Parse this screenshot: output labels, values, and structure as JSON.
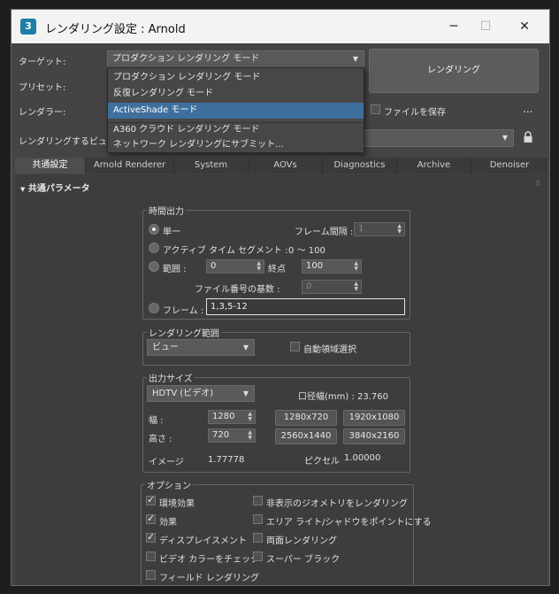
{
  "window": {
    "app_icon": "3",
    "title": "レンダリング設定 : Arnold",
    "minimize": "─",
    "maximize": "☐",
    "close": "✕"
  },
  "header": {
    "target_label": "ターゲット:",
    "target_value": "プロダクション レンダリング モード",
    "preset_label": "プリセット:",
    "renderer_label": "レンダラー:",
    "save_file_label": "ファイルを保存",
    "more": "...",
    "view_label": "レンダリングするビュー:",
    "render_button": "レンダリング",
    "lock_icon": "lock-icon"
  },
  "target_menu": {
    "items": [
      "プロダクション レンダリング モード",
      "反復レンダリング モード",
      "ActiveShade モード",
      "A360 クラウド レンダリング モード",
      "ネットワーク レンダリングにサブミット..."
    ],
    "selected_index": 2
  },
  "tabs": [
    "共通設定",
    "Arnold Renderer",
    "System",
    "AOVs",
    "Diagnostics",
    "Archive",
    "Denoiser"
  ],
  "section": {
    "title": "共通パラメータ",
    "collapse_icon": "▼"
  },
  "time_output": {
    "title": "時間出力",
    "single": "単一",
    "frame_interval_label": "フレーム間隔 :",
    "frame_interval_value": "1",
    "active_segment": "アクティブ タイム セグメント :",
    "active_segment_value": "0 〜 100",
    "range": "範囲 :",
    "range_start": "0",
    "range_end_label": "終点",
    "range_end": "100",
    "file_number_label": "ファイル番号の基数 :",
    "file_number_value": "0",
    "frames": "フレーム :",
    "frames_value": "1,3,5-12"
  },
  "render_area": {
    "title": "レンダリング範囲",
    "value": "ビュー",
    "auto_region": "自動領域選択"
  },
  "output_size": {
    "title": "出力サイズ",
    "preset": "HDTV (ビデオ)",
    "aperture": "口径幅(mm) : 23.760",
    "width_label": "幅 :",
    "width": "1280",
    "height_label": "高さ :",
    "height": "720",
    "presets": [
      "1280x720",
      "1920x1080",
      "2560x1440",
      "3840x2160"
    ],
    "image_aspect_label": "イメージ",
    "image_aspect": "1.77778",
    "pixel_aspect_label": "ピクセル",
    "pixel_aspect": "1.00000"
  },
  "options": {
    "title": "オプション",
    "left": [
      {
        "label": "環境効果",
        "checked": true
      },
      {
        "label": "効果",
        "checked": true
      },
      {
        "label": "ディスプレイスメント",
        "checked": true
      },
      {
        "label": "ビデオ カラーをチェック",
        "checked": false
      },
      {
        "label": "フィールド レンダリング",
        "checked": false
      }
    ],
    "right": [
      {
        "label": "非表示のジオメトリをレンダリング",
        "checked": false
      },
      {
        "label": "エリア ライト/シャドウをポイントにする",
        "checked": false
      },
      {
        "label": "両面レンダリング",
        "checked": false
      },
      {
        "label": "スーパー ブラック",
        "checked": false
      }
    ]
  }
}
